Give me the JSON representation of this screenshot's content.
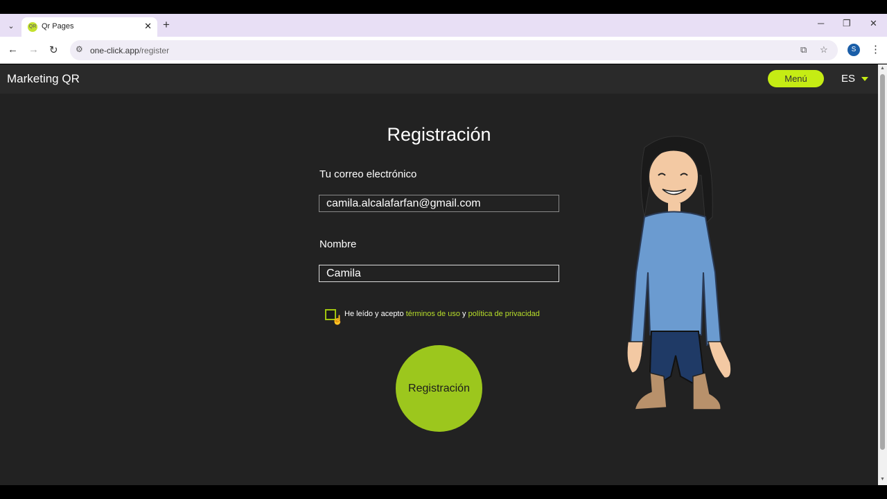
{
  "browser": {
    "tab_title": "Qr Pages",
    "favicon_text": "QR",
    "url_host": "one-click.app",
    "url_path": "/register",
    "profile_initial": "S",
    "icons": [
      "tab-list-icon",
      "close-icon",
      "plus-icon",
      "minimize-icon",
      "restore-icon",
      "close-window-icon",
      "back-icon",
      "forward-icon",
      "reload-icon",
      "site-info-icon",
      "translate-icon",
      "star-icon",
      "kebab-menu-icon"
    ]
  },
  "header": {
    "brand": "Marketing QR",
    "menu_label": "Menú",
    "language": "ES",
    "accent_color": "#c5ec14"
  },
  "form": {
    "title": "Registración",
    "email_label": "Tu correo electrónico",
    "email_value": "camila.alcalafarfan@gmail.com",
    "name_label": "Nombre",
    "name_value": "Camila",
    "terms_prefix": "He leído y acepto",
    "terms_link": "términos de uso",
    "terms_and": "y",
    "privacy_link": "política de privacidad",
    "terms_checked": false,
    "submit_label": "Registración",
    "submit_color": "#9cc71d"
  }
}
